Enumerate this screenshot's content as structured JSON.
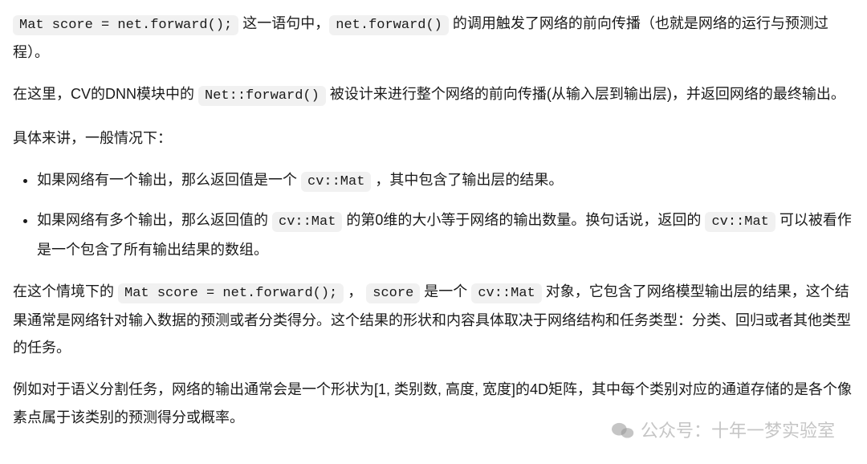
{
  "para1": {
    "code1": "Mat score = net.forward();",
    "t1": " 这一语句中，",
    "code2": "net.forward()",
    "t2": " 的调用触发了网络的前向传播（也就是网络的运行与预测过程）。"
  },
  "para2": {
    "t1": "在这里，CV的DNN模块中的 ",
    "code1": "Net::forward()",
    "t2": " 被设计来进行整个网络的前向传播(从输入层到输出层)，并返回网络的最终输出。"
  },
  "para3": {
    "t1": "具体来讲，一般情况下："
  },
  "list": {
    "item1": {
      "t1": "如果网络有一个输出，那么返回值是一个 ",
      "code1": "cv::Mat",
      "t2": " ，其中包含了输出层的结果。"
    },
    "item2": {
      "t1": "如果网络有多个输出，那么返回值的 ",
      "code1": "cv::Mat",
      "t2": " 的第0维的大小等于网络的输出数量。换句话说，返回的 ",
      "code2": "cv::Mat",
      "t3": " 可以被看作是一个包含了所有输出结果的数组。"
    }
  },
  "para4": {
    "t1": "在这个情境下的 ",
    "code1": "Mat score = net.forward();",
    "t2": " ， ",
    "code2": "score",
    "t3": " 是一个 ",
    "code3": "cv::Mat",
    "t4": " 对象，它包含了网络模型输出层的结果，这个结果通常是网络针对输入数据的预测或者分类得分。这个结果的形状和内容具体取决于网络结构和任务类型：分类、回归或者其他类型的任务。"
  },
  "para5": {
    "t1": "例如对于语义分割任务，网络的输出通常会是一个形状为[1, 类别数, 高度, 宽度]的4D矩阵，其中每个类别对应的通道存储的是各个像素点属于该类别的预测得分或概率。"
  },
  "watermark": {
    "text": "公众号：十年一梦实验室"
  }
}
